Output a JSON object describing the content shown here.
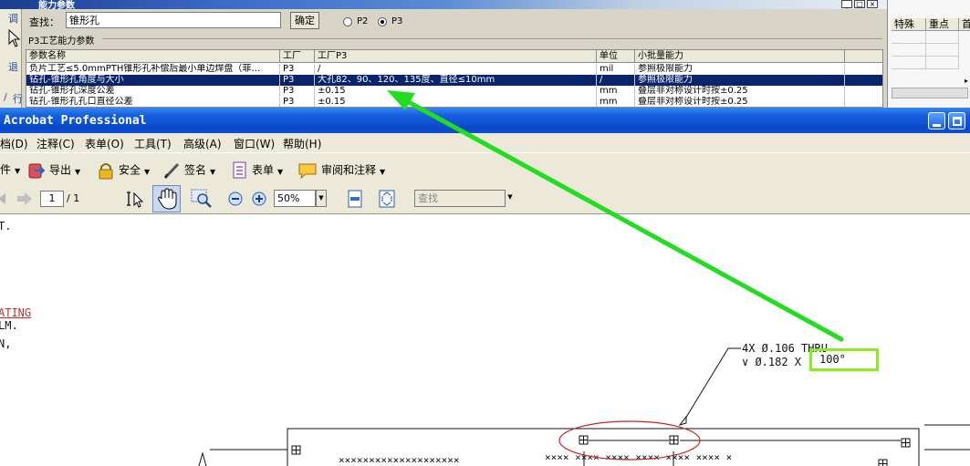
{
  "params_window": {
    "title": "能力参数",
    "left_strip": [
      "调",
      "退",
      "/",
      "行"
    ],
    "search_label": "查找：",
    "search_value": "锥形孔",
    "confirm_label": "确定",
    "radio_p2": "P2",
    "radio_p3": "P3",
    "selected_radio": "P3",
    "group_label": "P3工艺能力参数",
    "columns": [
      "参数名称",
      "工厂",
      "工厂P3",
      "单位",
      "小批量能力"
    ],
    "rows": [
      [
        "负片工艺≤5.0mmPTH锥形孔补偿后最小单边焊盘（菲…",
        "P3",
        "/",
        "mil",
        "参照极限能力"
      ],
      [
        "钻孔-锥形孔角度与大小",
        "P3",
        "大孔82、90、120、135度、直径≤10mm",
        "/",
        "参照极限能力"
      ],
      [
        "钻孔-锥形孔深度公差",
        "P3",
        "±0.15",
        "mm",
        "叠层非对称设计时按±0.25"
      ],
      [
        "钻孔-锥形孔孔口直径公差",
        "P3",
        "±0.15",
        "mm",
        "叠层非对称设计时按±0.25"
      ]
    ],
    "selected_row": 1,
    "right_panel_headers": [
      "特殊",
      "重点",
      "首"
    ]
  },
  "acrobat": {
    "title": "Acrobat Professional",
    "menu": [
      "档(D)",
      "注释(C)",
      "表单(O)",
      "工具(T)",
      "高级(A)",
      "窗口(W)",
      "帮助(H)"
    ],
    "toolbar": [
      "件",
      "导出",
      "安全",
      "签名",
      "表单",
      "审阅和注释"
    ],
    "page_current": "1",
    "page_total": "/ 1",
    "zoom": "50%",
    "find_placeholder": "查找"
  },
  "drawing": {
    "left_text": [
      "T.",
      "ATING",
      "LM.",
      "N,"
    ],
    "callout_line1": "4X Ø.106 THRU",
    "callout_line2": "∨ Ø.182 X",
    "callout_angle": "100°",
    "xrow_left": "××××××××××××××××××××",
    "xrow_right": "××××  ××××  ××××  ××××  ××××  ××××  ×",
    "highlight_color": "#88ee22",
    "arrow_color": "#22dd22",
    "ellipse_color": "#cc2222"
  }
}
